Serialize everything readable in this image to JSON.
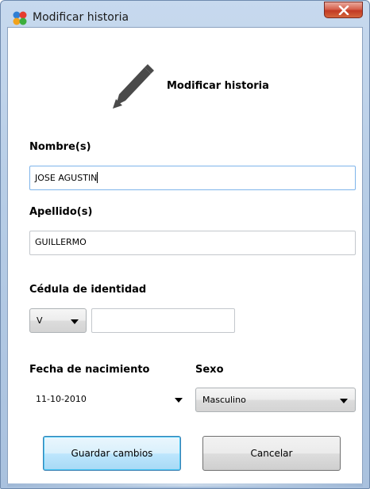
{
  "window": {
    "title": "Modificar historia",
    "close_glyph": "X"
  },
  "header": {
    "icon": "pencil-icon",
    "title": "Modificar historia"
  },
  "form": {
    "nombres_label": "Nombre(s)",
    "nombres_value": "JOSE AGUSTIN",
    "apellidos_label": "Apellido(s)",
    "apellidos_value": "GUILLERMO",
    "cedula_label": "Cédula de identidad",
    "cedula_type": "V",
    "cedula_value": "",
    "fecha_label": "Fecha de nacimiento",
    "fecha_value": "11-10-2010",
    "sexo_label": "Sexo",
    "sexo_value": "Masculino"
  },
  "buttons": {
    "save": "Guardar cambios",
    "cancel": "Cancelar"
  },
  "colors": {
    "titlebar": "#b7cde6",
    "close_button": "#c23a24",
    "default_button_border": "#3c7fb1",
    "focused_input_border": "#7eb4ea",
    "pencil": "#4a4a4a"
  }
}
